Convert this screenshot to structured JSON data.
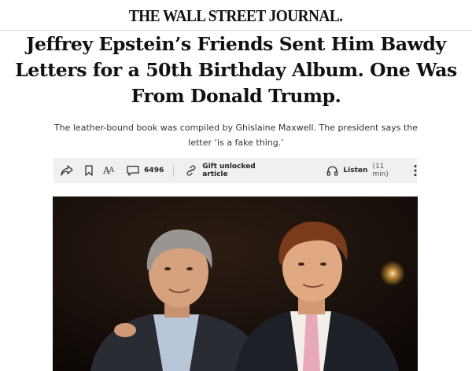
{
  "masthead": {
    "logo_text": "THE WALL STREET JOURNAL."
  },
  "article": {
    "headline": "Jeffrey Epstein’s Friends Sent Him Bawdy Letters for a 50th Birthday Album. One Was From Donald Trump.",
    "dek": "The leather-bound book was compiled by Ghislaine Maxwell. The president says the letter ‘is a fake thing.’"
  },
  "toolbar": {
    "comment_count": "6496",
    "gift_label": "Gift unlocked article",
    "listen_label": "Listen",
    "listen_duration": "(11 min)",
    "icons": [
      "share-icon",
      "bookmark-icon",
      "text-size-icon",
      "comment-icon",
      "gift-link-icon",
      "headphones-icon",
      "more-icon"
    ]
  },
  "colors": {
    "toolbar_background": "#f0f0f0",
    "photo_background": "#1b130e"
  }
}
